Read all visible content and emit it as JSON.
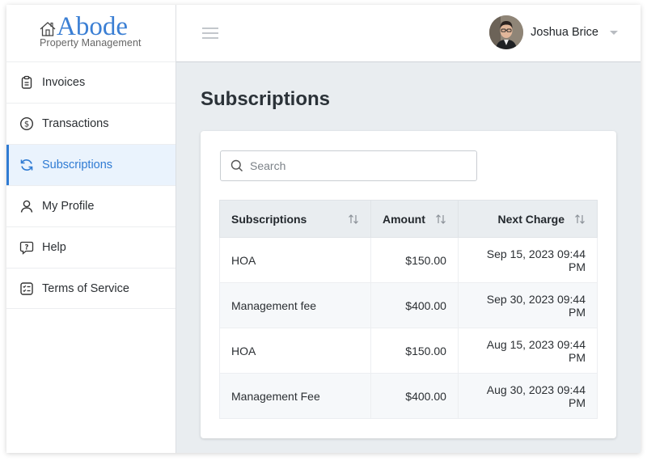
{
  "brand": {
    "name": "Abode",
    "tagline": "Property Management"
  },
  "sidebar": {
    "items": [
      {
        "label": "Invoices",
        "icon": "clipboard-icon"
      },
      {
        "label": "Transactions",
        "icon": "dollar-circle-icon"
      },
      {
        "label": "Subscriptions",
        "icon": "refresh-icon",
        "active": true
      },
      {
        "label": "My Profile",
        "icon": "user-icon"
      },
      {
        "label": "Help",
        "icon": "help-bubble-icon"
      },
      {
        "label": "Terms of Service",
        "icon": "checklist-icon"
      }
    ]
  },
  "header": {
    "user_name": "Joshua Brice"
  },
  "main": {
    "title": "Subscriptions",
    "search": {
      "placeholder": "Search",
      "value": ""
    },
    "table": {
      "columns": [
        "Subscriptions",
        "Amount",
        "Next Charge"
      ],
      "rows": [
        {
          "name": "HOA",
          "amount": "$150.00",
          "next_charge": "Sep 15, 2023 09:44 PM"
        },
        {
          "name": "Management fee",
          "amount": "$400.00",
          "next_charge": "Sep 30, 2023 09:44 PM"
        },
        {
          "name": "HOA",
          "amount": "$150.00",
          "next_charge": "Aug 15, 2023 09:44 PM"
        },
        {
          "name": "Management Fee",
          "amount": "$400.00",
          "next_charge": "Aug 30, 2023 09:44 PM"
        }
      ]
    }
  },
  "colors": {
    "accent": "#2f7bd3",
    "brand": "#3b7fd4",
    "background": "#e9edf0"
  }
}
